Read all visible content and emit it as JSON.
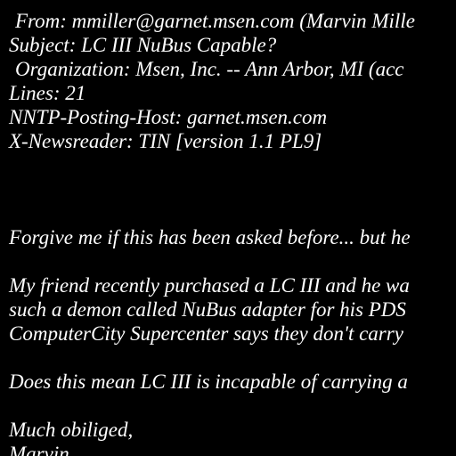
{
  "headers": {
    "from": "From: mmiller@garnet.msen.com (Marvin Mille",
    "subject": "Subject: LC III NuBus Capable?",
    "organization": "Organization: Msen, Inc. -- Ann Arbor, MI (acc",
    "lines": "Lines: 21",
    "nntp_posting_host": "NNTP-Posting-Host: garnet.msen.com",
    "x_newsreader": "X-Newsreader: TIN [version 1.1 PL9]"
  },
  "body": {
    "line_1": "Forgive me if this has been asked before... but he",
    "line_2": "My friend recently purchased a LC III and he wa",
    "line_3": "such a demon called NuBus adapter for his PDS",
    "line_4": "ComputerCity Supercenter says they don't carry",
    "line_5": "Does this mean LC III is incapable of carrying a",
    "line_6": "Much obiliged,",
    "line_7": "Marvin"
  }
}
